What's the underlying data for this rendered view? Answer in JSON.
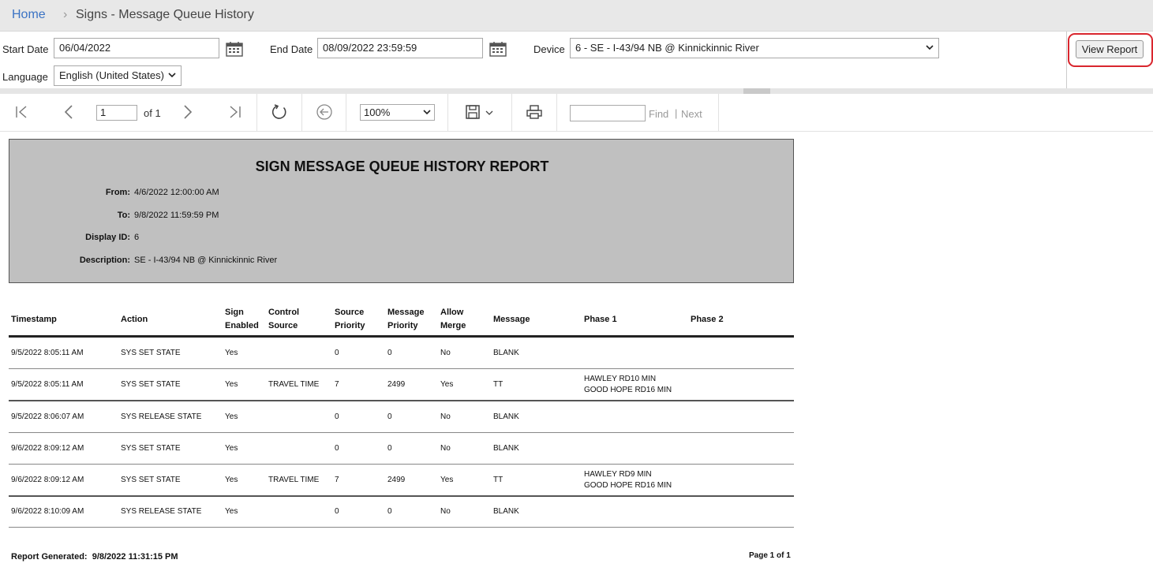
{
  "breadcrumb": {
    "home": "Home",
    "separator": "›",
    "title": "Signs - Message Queue History"
  },
  "params": {
    "start_date_label": "Start Date",
    "start_date_value": "06/04/2022",
    "end_date_label": "End Date",
    "end_date_value": "08/09/2022 23:59:59",
    "device_label": "Device",
    "device_value": "6 - SE - I-43/94 NB @ Kinnickinnic River",
    "language_label": "Language",
    "language_value": "English (United States)",
    "view_report": "View Report"
  },
  "toolbar": {
    "page_value": "1",
    "of_text": "of 1",
    "zoom_value": "100%",
    "find_label": "Find",
    "pipe": "|",
    "next_label": "Next"
  },
  "report": {
    "title": "SIGN MESSAGE QUEUE HISTORY REPORT",
    "from_label": "From:",
    "from_value": "4/6/2022 12:00:00 AM",
    "to_label": "To:",
    "to_value": "9/8/2022 11:59:59 PM",
    "display_label": "Display ID:",
    "display_value": "6",
    "desc_label": "Description:",
    "desc_value": "SE - I-43/94 NB @ Kinnickinnic River",
    "columns": [
      "Timestamp",
      "Action",
      "Sign\nEnabled",
      "Control\nSource",
      "Source\nPriority",
      "Message\nPriority",
      "Allow\nMerge",
      "Message",
      "Phase 1",
      "Phase 2"
    ],
    "rows": [
      [
        "9/5/2022 8:05:11 AM",
        "SYS SET STATE",
        "Yes",
        "",
        "0",
        "0",
        "No",
        "BLANK",
        "",
        ""
      ],
      [
        "9/5/2022 8:05:11 AM",
        "SYS SET STATE",
        "Yes",
        "TRAVEL TIME",
        "7",
        "2499",
        "Yes",
        "TT",
        "HAWLEY RD10 MIN\nGOOD HOPE RD16 MIN",
        ""
      ],
      [
        "9/5/2022 8:06:07 AM",
        "SYS RELEASE STATE",
        "Yes",
        "",
        "0",
        "0",
        "No",
        "BLANK",
        "",
        ""
      ],
      [
        "9/6/2022 8:09:12 AM",
        "SYS SET STATE",
        "Yes",
        "",
        "0",
        "0",
        "No",
        "BLANK",
        "",
        ""
      ],
      [
        "9/6/2022 8:09:12 AM",
        "SYS SET STATE",
        "Yes",
        "TRAVEL TIME",
        "7",
        "2499",
        "Yes",
        "TT",
        "HAWLEY RD9 MIN\nGOOD HOPE RD16 MIN",
        ""
      ],
      [
        "9/6/2022 8:10:09 AM",
        "SYS RELEASE STATE",
        "Yes",
        "",
        "0",
        "0",
        "No",
        "BLANK",
        "",
        ""
      ]
    ],
    "generated_label": "Report Generated:",
    "generated_value": "9/8/2022 11:31:15 PM",
    "page_footer": "Page 1 of 1"
  },
  "icons": {
    "calendar": "calendar-icon",
    "first": "first-page-icon",
    "prev": "previous-page-icon",
    "next": "next-page-icon",
    "last": "last-page-icon",
    "refresh": "refresh-icon",
    "back": "back-icon",
    "save": "save-icon",
    "print": "print-icon"
  },
  "colors": {
    "link": "#3b73c4",
    "highlight": "#d9262e",
    "report_header_bg": "#c0c0c0"
  }
}
